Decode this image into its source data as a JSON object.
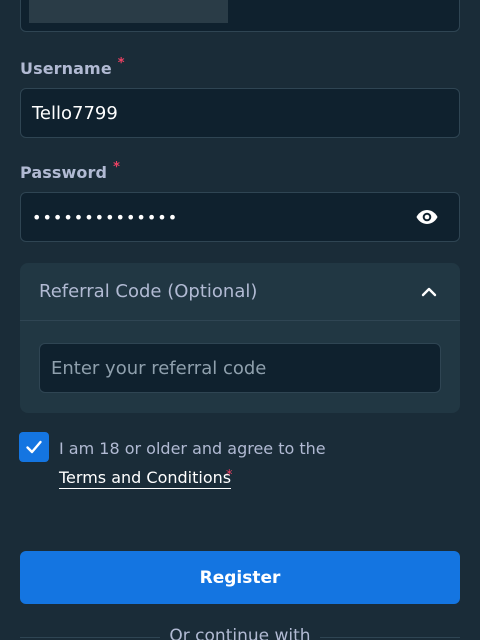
{
  "form": {
    "username": {
      "label": "Username",
      "required_mark": "*",
      "value": "Tello7799"
    },
    "password": {
      "label": "Password",
      "required_mark": "*",
      "masked_value": "••••••••••••••",
      "toggle_icon": "eye-icon"
    },
    "referral": {
      "title": "Referral Code (Optional)",
      "expanded": true,
      "placeholder": "Enter your referral code"
    },
    "agreement": {
      "checked": true,
      "text": "I am 18 or older and agree to the",
      "link_text": "Terms and Conditions",
      "required_mark": "*"
    },
    "register_label": "Register",
    "alt_login_text": "Or continue with"
  },
  "colors": {
    "background": "#1a2c38",
    "input_bg": "#0f212e",
    "accent": "#1475e1",
    "required": "#ed4163",
    "label": "#b1bad3"
  }
}
